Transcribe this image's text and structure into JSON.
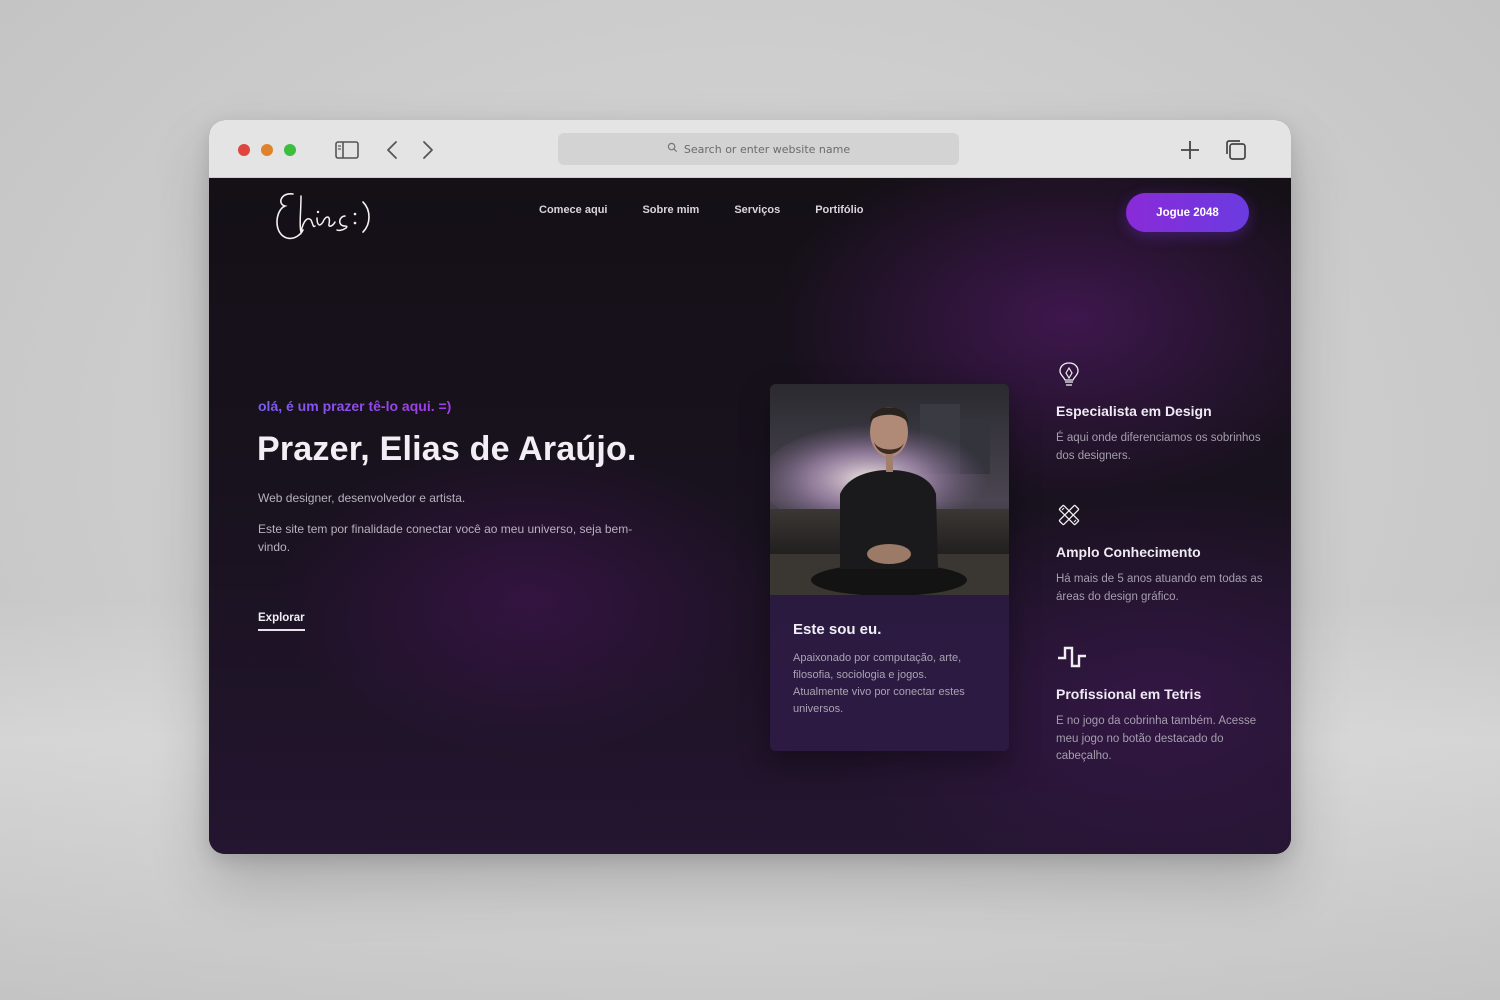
{
  "browser": {
    "url_placeholder": "Search or enter website name",
    "icons": [
      "sidebar-icon",
      "back-icon",
      "forward-icon",
      "new-tab-icon",
      "tabs-overview-icon",
      "search-icon"
    ],
    "traffic_lights": {
      "close": "#e0443e",
      "minimize": "#e0822b",
      "maximize": "#3bbd3d"
    }
  },
  "header": {
    "logo_text": "Elias :)",
    "nav": [
      {
        "label": "Comece aqui"
      },
      {
        "label": "Sobre mim"
      },
      {
        "label": "Serviços"
      },
      {
        "label": "Portifólio"
      }
    ],
    "cta_label": "Jogue 2048"
  },
  "hero": {
    "greeting": "olá, é um prazer tê-lo aqui. =)",
    "title": "Prazer, Elias de Araújo.",
    "subtitle": "Web designer, desenvolvedor e artista.",
    "description": "Este site tem por finalidade conectar você ao meu universo, seja bem-vindo.",
    "explore_label": "Explorar"
  },
  "profile_card": {
    "title": "Este sou eu.",
    "text": "Apaixonado por computação, arte, filosofia, sociologia e jogos. Atualmente vivo por conectar estes universos."
  },
  "features": [
    {
      "icon": "lightbulb-pen-icon",
      "title": "Especialista em Design",
      "text": "É aqui onde diferenciamos os sobrinhos dos designers."
    },
    {
      "icon": "tools-cross-icon",
      "title": "Amplo Conhecimento",
      "text": "Há mais de 5 anos atuando em todas as áreas do design gráfico."
    },
    {
      "icon": "tetris-block-icon",
      "title": "Profissional em Tetris",
      "text": "E no jogo da cobrinha também. Acesse meu jogo no botão destacado do cabeçalho."
    }
  ],
  "colors": {
    "accent_purple": "#8a2bd8",
    "accent_violet": "#6a3be0",
    "background_dark": "#141016"
  }
}
